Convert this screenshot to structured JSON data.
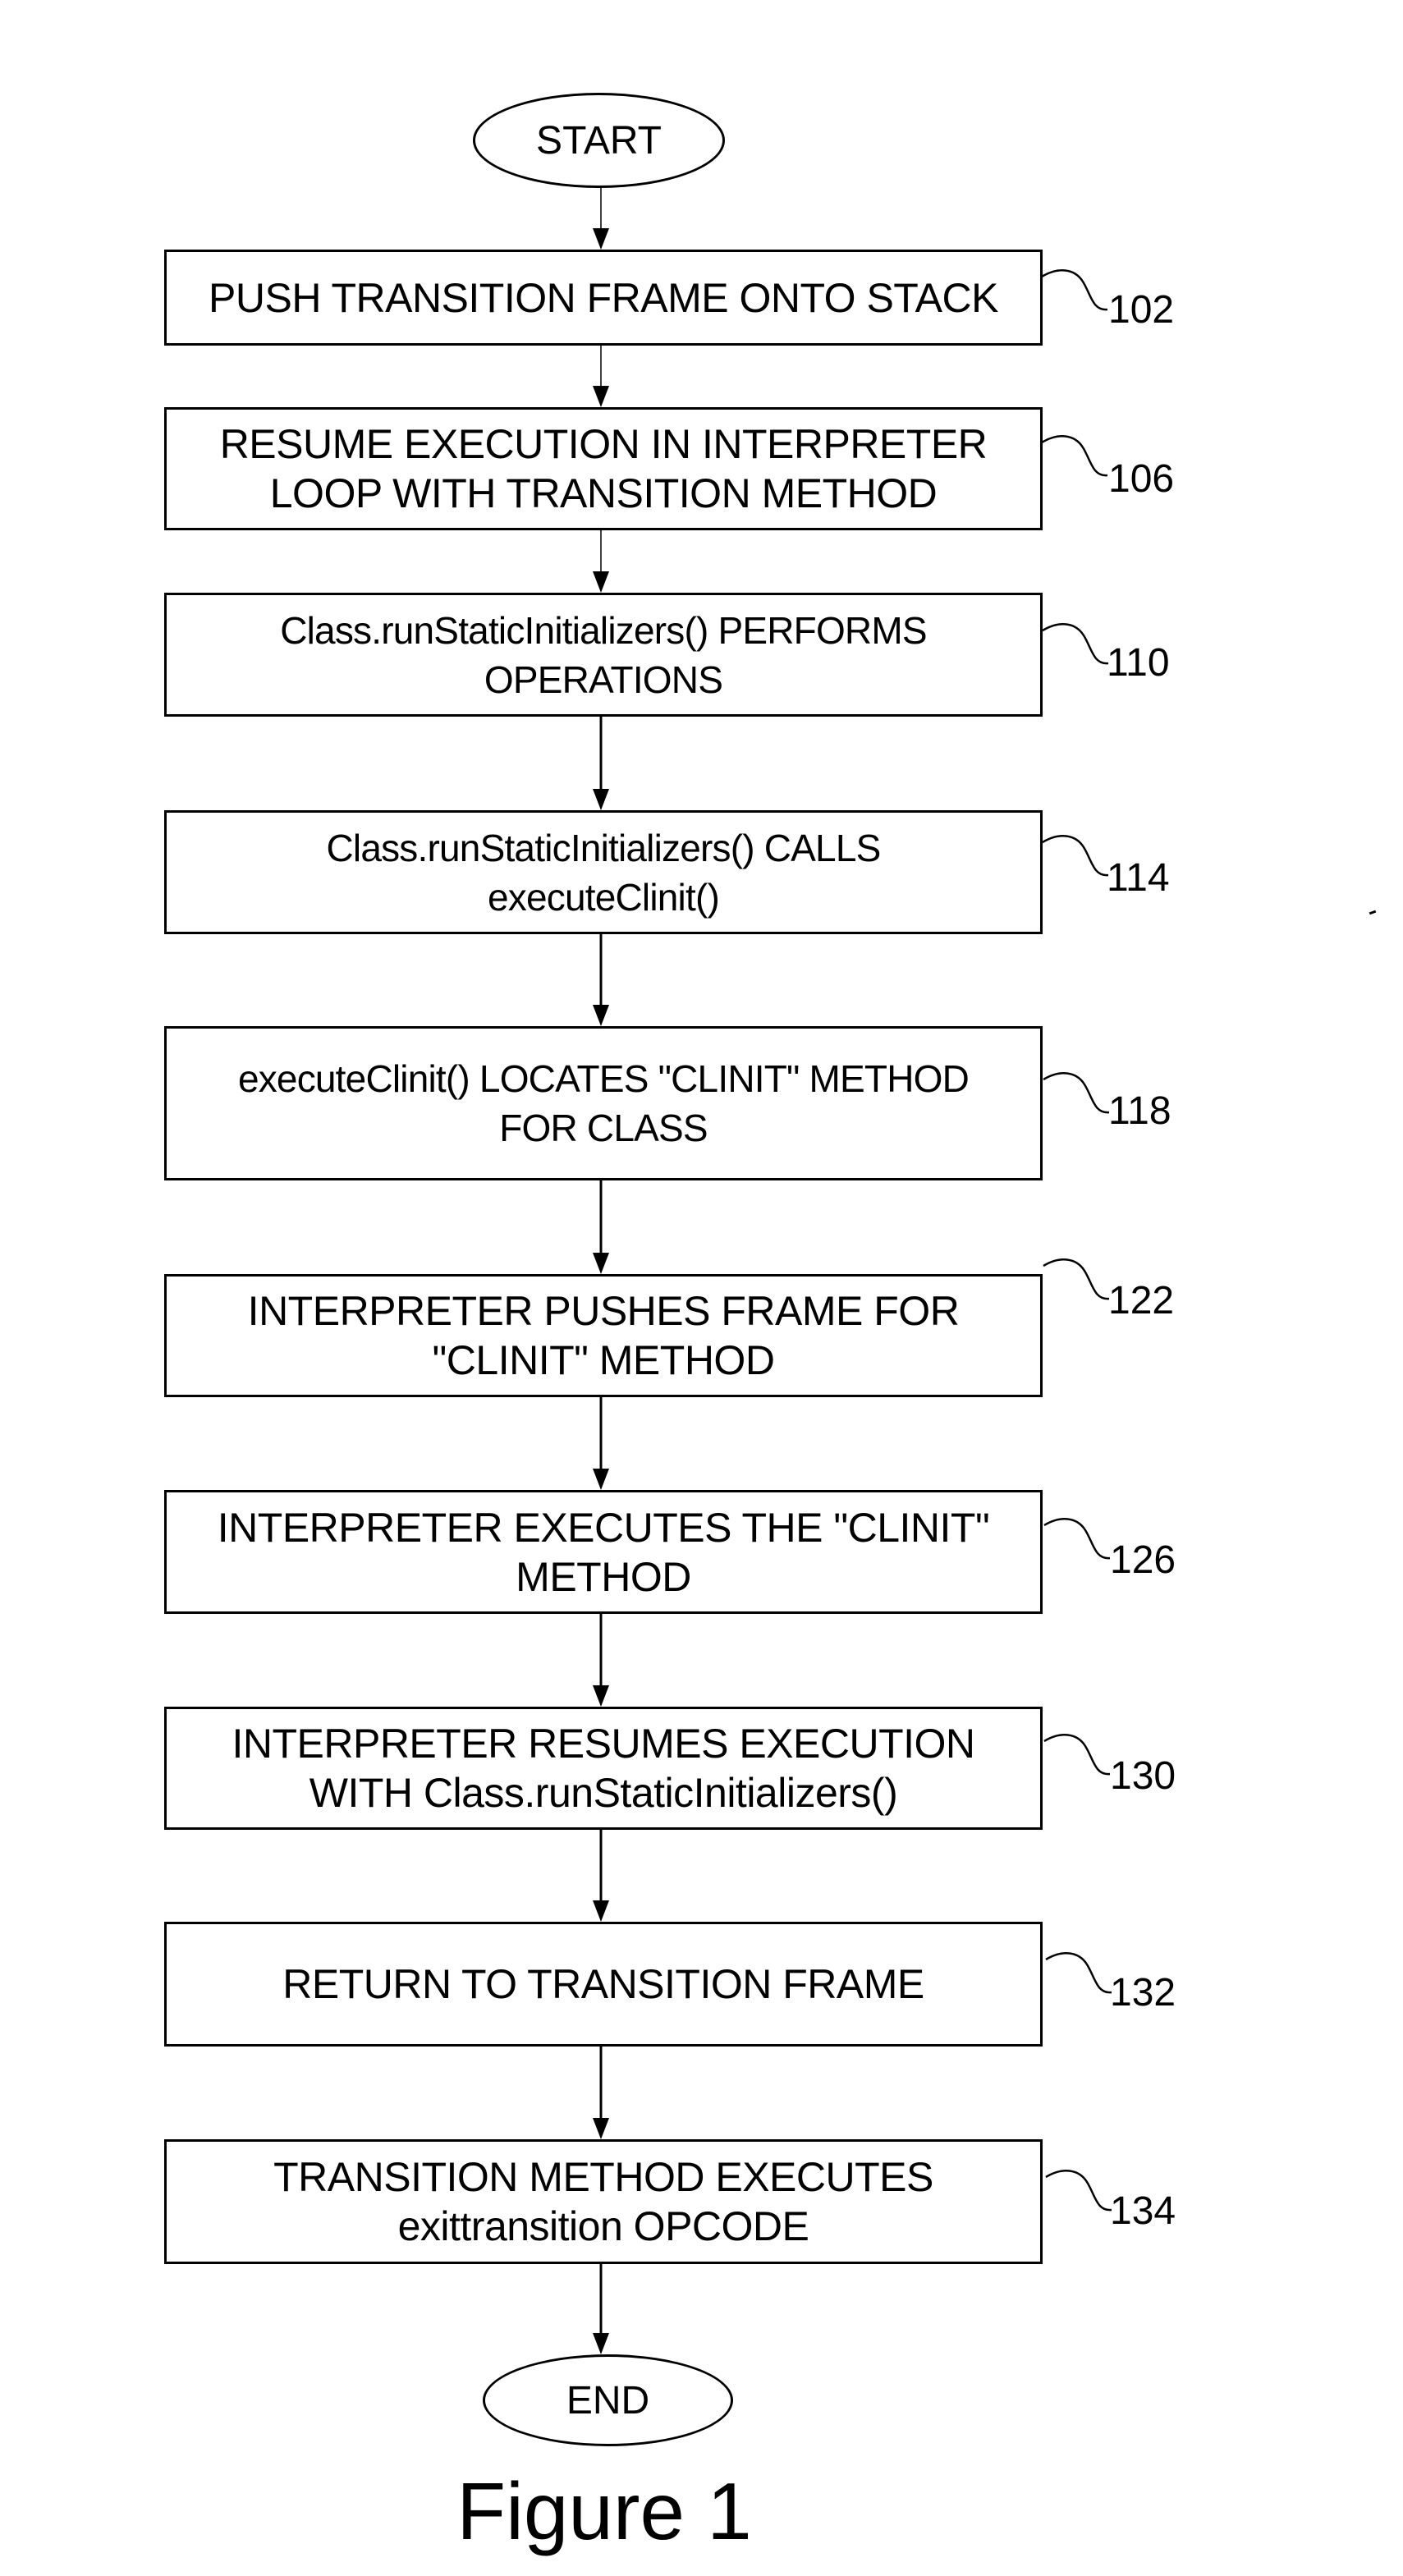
{
  "figure": {
    "caption": "Figure 1"
  },
  "terminators": {
    "start": "START",
    "end": "END"
  },
  "steps": [
    {
      "ref": "102",
      "text": "PUSH TRANSITION FRAME ONTO STACK"
    },
    {
      "ref": "106",
      "text": "RESUME EXECUTION IN INTERPRETER\nLOOP WITH TRANSITION METHOD"
    },
    {
      "ref": "110",
      "text": "Class.runStaticInitializers() PERFORMS\nOPERATIONS"
    },
    {
      "ref": "114",
      "text": "Class.runStaticInitializers() CALLS\nexecuteClinit()"
    },
    {
      "ref": "118",
      "text": "executeClinit() LOCATES \"CLINIT\" METHOD\nFOR CLASS"
    },
    {
      "ref": "122",
      "text": "INTERPRETER  PUSHES FRAME FOR\n\"CLINIT\" METHOD"
    },
    {
      "ref": "126",
      "text": "INTERPRETER EXECUTES THE \"CLINIT\"\nMETHOD"
    },
    {
      "ref": "130",
      "text": "INTERPRETER RESUMES EXECUTION\nWITH Class.runStaticInitializers()"
    },
    {
      "ref": "132",
      "text": "RETURN TO TRANSITION FRAME"
    },
    {
      "ref": "134",
      "text": "TRANSITION METHOD EXECUTES\nexittransition OPCODE"
    }
  ]
}
